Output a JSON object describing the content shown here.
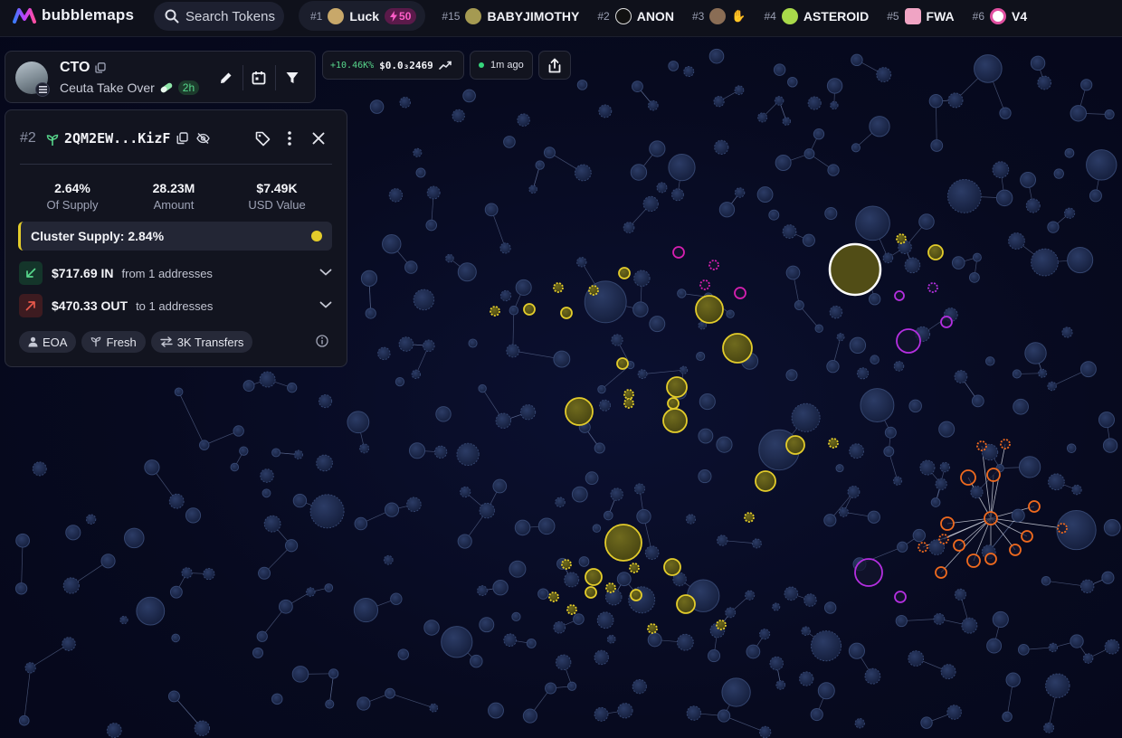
{
  "app": {
    "logo_text": "bubblemaps"
  },
  "search": {
    "placeholder": "Search Tokens"
  },
  "trending": [
    {
      "rank": "#1",
      "name": "Luck",
      "badge": "50",
      "avatar_color": "#c8a86a"
    },
    {
      "rank": "#15",
      "name": "BABYJIMOTHY",
      "avatar_color": "#a59a52"
    },
    {
      "rank": "#2",
      "name": "ANON",
      "avatar_color": "#111111"
    },
    {
      "rank": "#3",
      "name": "",
      "avatar_color": "#8a6d55"
    },
    {
      "rank": "#4",
      "name": "ASTEROID",
      "avatar_color": "#a8d94a"
    },
    {
      "rank": "#5",
      "name": "FWA",
      "avatar_color": "#f0a4c4"
    },
    {
      "rank": "#6",
      "name": "V4",
      "avatar_color": "#ffffff"
    }
  ],
  "token": {
    "symbol": "CTO",
    "full_name": "Ceuta Take Over",
    "age": "2h"
  },
  "price": {
    "change": "+10.46K%",
    "value": "$0.0₃2469"
  },
  "updated": {
    "text": "1m ago"
  },
  "wallet": {
    "rank": "#2",
    "address": "2QM2EW...KizF",
    "stats": [
      {
        "value": "2.64%",
        "label": "Of Supply"
      },
      {
        "value": "28.23M",
        "label": "Amount"
      },
      {
        "value": "$7.49K",
        "label": "USD Value"
      }
    ],
    "cluster_supply": "Cluster Supply: 2.84%",
    "inflow": {
      "amount": "$717.69 IN",
      "desc": "from 1 addresses"
    },
    "outflow": {
      "amount": "$470.33 OUT",
      "desc": "to 1 addresses"
    },
    "tags": [
      "EOA",
      "Fresh",
      "3K Transfers"
    ]
  },
  "colors": {
    "cluster_yellow": "#e3cc2b",
    "cluster_purple": "#b42fe0",
    "cluster_magenta": "#d61fb0",
    "cluster_orange": "#f06a1e",
    "bubble_default": "#1c2a4e",
    "positive": "#57d68b",
    "negative": "#e8584a"
  }
}
